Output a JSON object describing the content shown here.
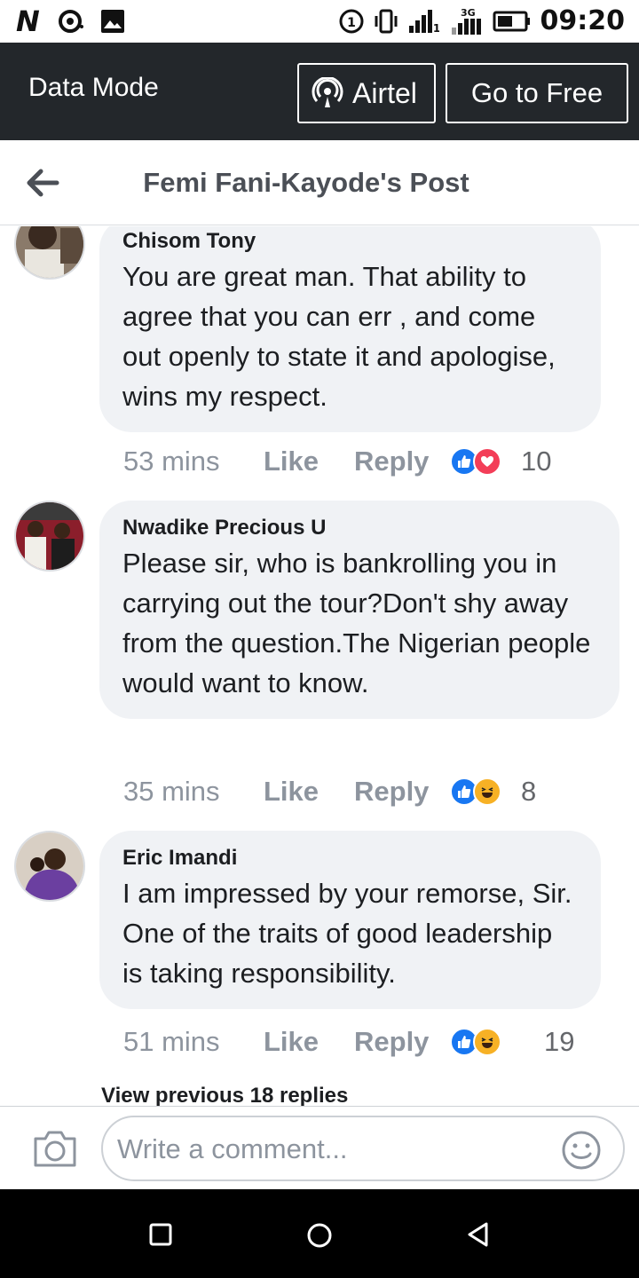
{
  "status_bar": {
    "carrier_badge": "N",
    "time": "09:20",
    "network_label": "3G",
    "icons": [
      "n-logo-icon",
      "record-icon",
      "image-icon",
      "sim-1-icon",
      "vibrate-icon",
      "signal-icon",
      "signal-3g-icon",
      "battery-icon"
    ]
  },
  "data_bar": {
    "title": "Data Mode",
    "airtel_label": "Airtel",
    "free_label": "Go to Free"
  },
  "header": {
    "title": "Femi Fani-Kayode's Post"
  },
  "comments": [
    {
      "author": "Chisom Tony",
      "text": "You are great man. That ability to agree that you can err , and come out  openly to state it and apologise, wins my respect.",
      "time": "53 mins",
      "like_label": "Like",
      "reply_label": "Reply",
      "reactions": [
        "like",
        "love"
      ],
      "reaction_count": "10"
    },
    {
      "author": "Nwadike Precious U",
      "text": "Please sir, who is bankrolling you in carrying out the tour?Don't shy away from the question.The Nigerian people would want to know.",
      "time": "35 mins",
      "like_label": "Like",
      "reply_label": "Reply",
      "reactions": [
        "like",
        "haha"
      ],
      "reaction_count": "8"
    },
    {
      "author": "Eric Imandi",
      "text": "I am impressed by your remorse, Sir. One of the traits of good leadership is taking responsibility.",
      "time": "51 mins",
      "like_label": "Like",
      "reply_label": "Reply",
      "reactions": [
        "like",
        "haha"
      ],
      "reaction_count": "19"
    }
  ],
  "view_previous": "View previous 18 replies",
  "composer": {
    "placeholder": "Write a comment..."
  },
  "colors": {
    "data_bar_bg": "#23272b",
    "bubble_bg": "#f0f2f5",
    "like_blue": "#1877f2",
    "love_red": "#f33e58",
    "haha_yellow": "#f7b125"
  }
}
